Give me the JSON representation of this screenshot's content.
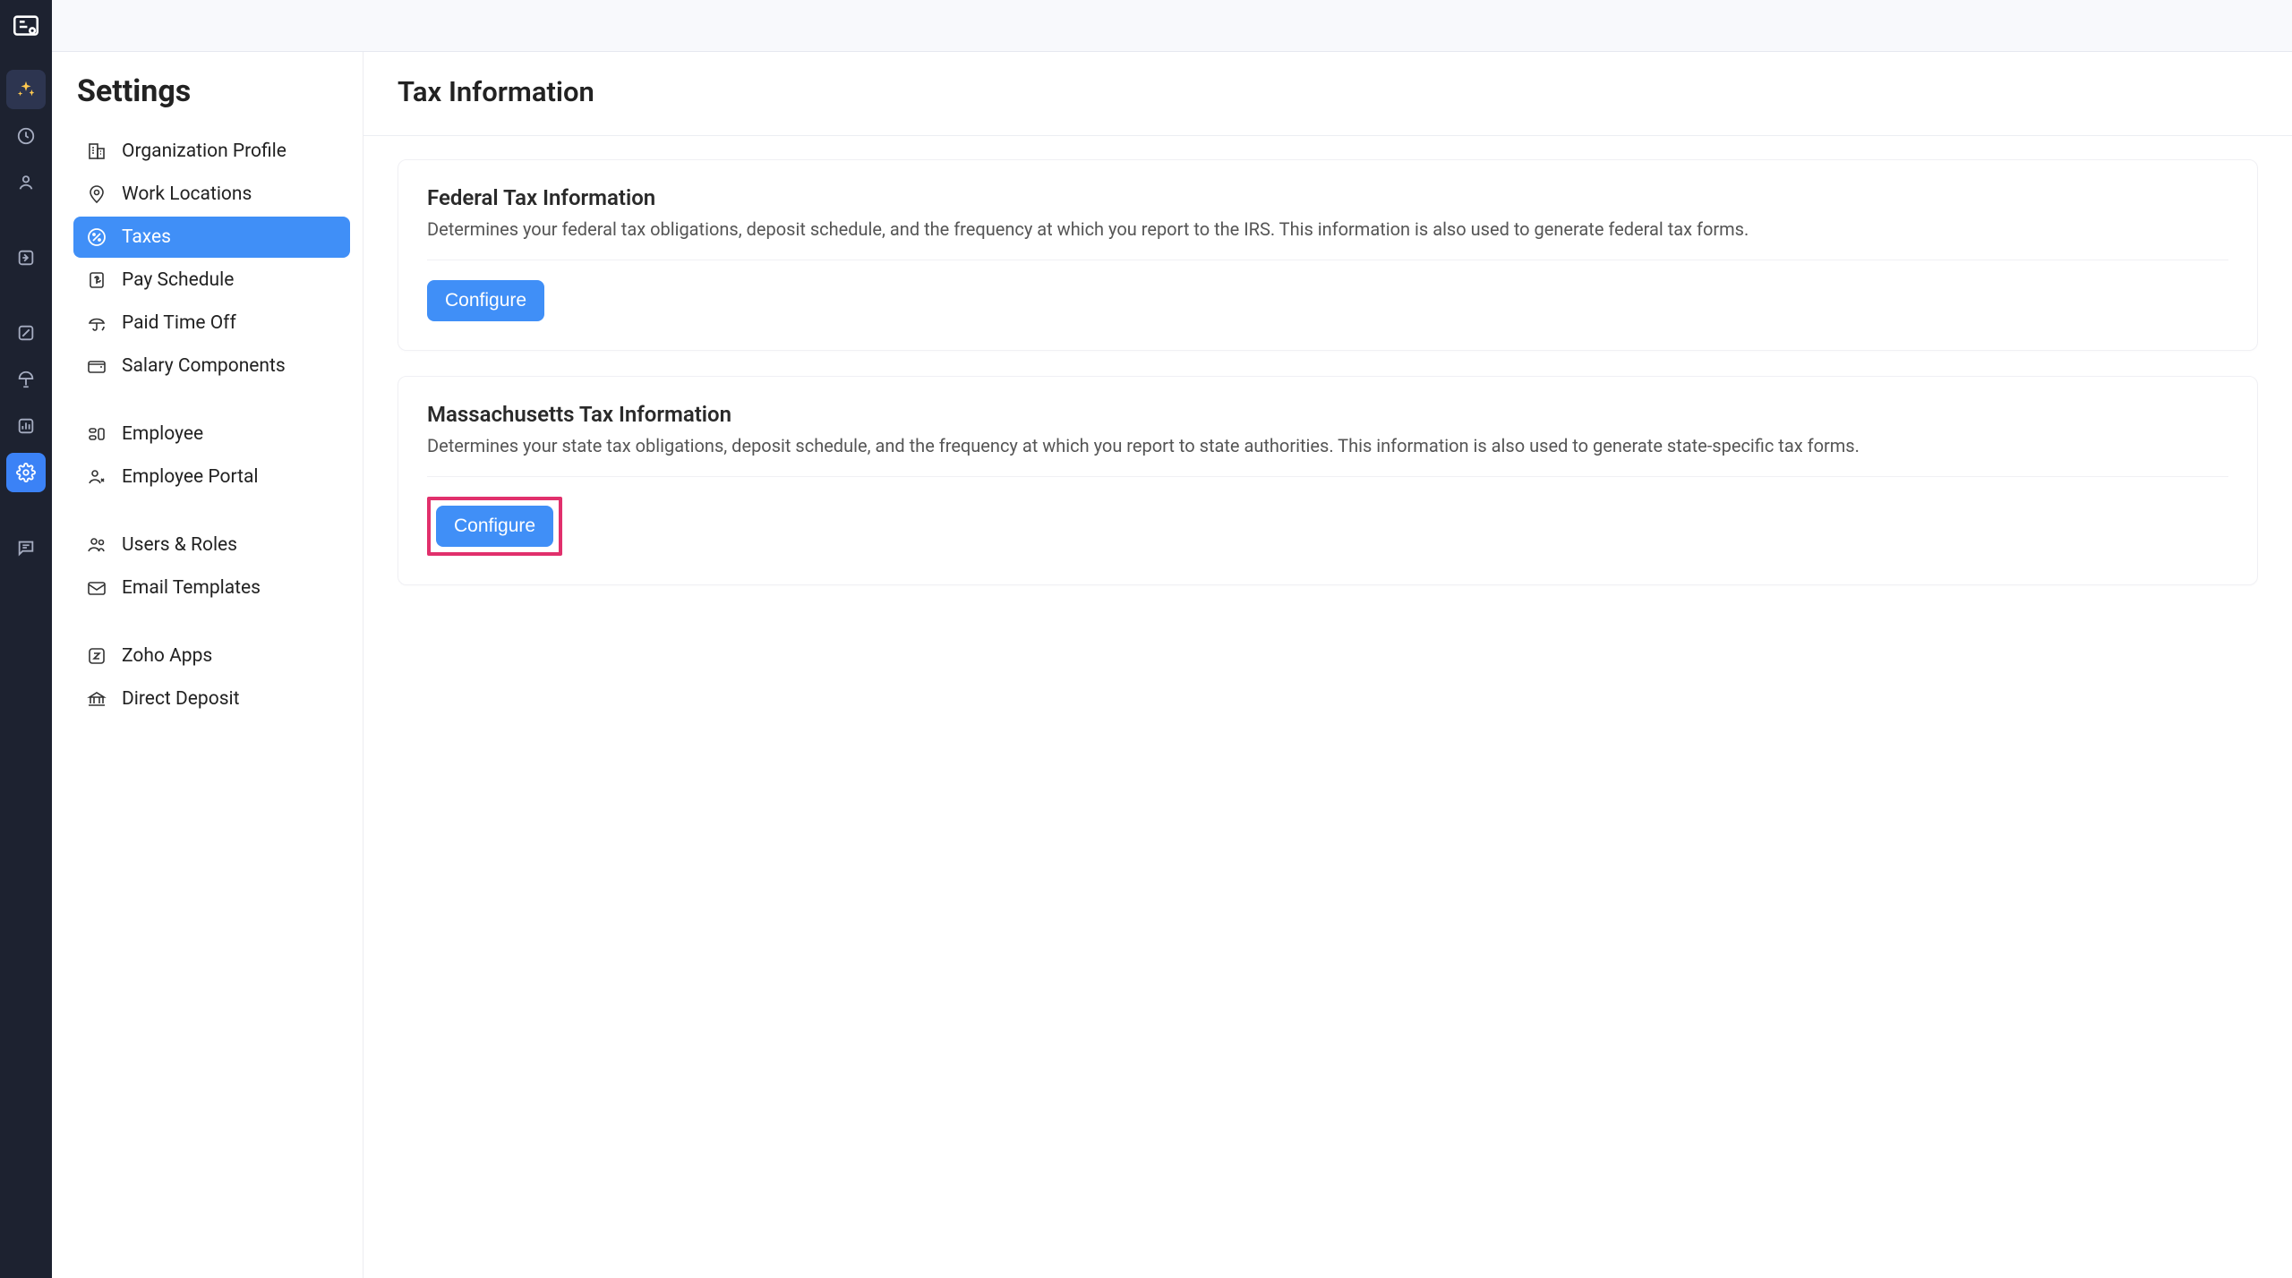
{
  "sidebar": {
    "title": "Settings",
    "items": [
      {
        "label": "Organization Profile",
        "icon": "building"
      },
      {
        "label": "Work Locations",
        "icon": "pin"
      },
      {
        "label": "Taxes",
        "icon": "percent",
        "active": true
      },
      {
        "label": "Pay Schedule",
        "icon": "dollar-doc"
      },
      {
        "label": "Paid Time Off",
        "icon": "umbrella"
      },
      {
        "label": "Salary Components",
        "icon": "wallet"
      }
    ],
    "group2": [
      {
        "label": "Employee",
        "icon": "employee"
      },
      {
        "label": "Employee Portal",
        "icon": "portal-user"
      }
    ],
    "group3": [
      {
        "label": "Users & Roles",
        "icon": "users"
      },
      {
        "label": "Email Templates",
        "icon": "envelope"
      }
    ],
    "group4": [
      {
        "label": "Zoho Apps",
        "icon": "z-app"
      },
      {
        "label": "Direct Deposit",
        "icon": "bank"
      }
    ]
  },
  "page": {
    "title": "Tax Information"
  },
  "cards": [
    {
      "title": "Federal Tax Information",
      "desc": "Determines your federal tax obligations, deposit schedule, and the frequency at which you report to the IRS. This information is also used to generate federal tax forms.",
      "button": "Configure"
    },
    {
      "title": "Massachusetts Tax Information",
      "desc": "Determines your state tax obligations, deposit schedule, and the frequency at which you report to state authorities. This information is also used to generate state-specific tax forms.",
      "button": "Configure",
      "highlighted": true
    }
  ]
}
